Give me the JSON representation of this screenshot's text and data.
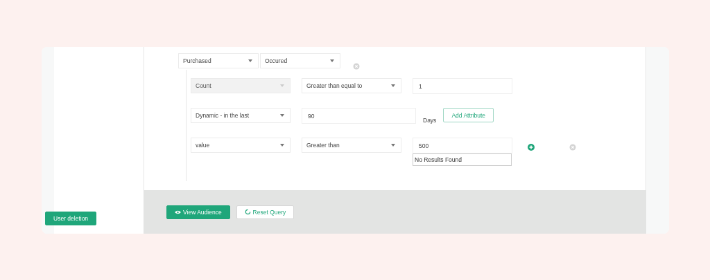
{
  "sidebar": {
    "button": "User deletion"
  },
  "event_row": {
    "selects": [
      {
        "value": "Purchased"
      },
      {
        "value": "Occured"
      }
    ],
    "can_remove": true
  },
  "conditions": [
    {
      "kind": "compare",
      "attribute": {
        "value": "Count",
        "disabled": true
      },
      "operator": "Greater than equal to",
      "value": "1"
    },
    {
      "kind": "range",
      "attribute": {
        "value": "Dynamic - in the last",
        "disabled": false
      },
      "value": "90",
      "unit": "Days",
      "button": "Add Attribute"
    },
    {
      "kind": "compare",
      "attribute": {
        "value": "value",
        "disabled": false
      },
      "operator": "Greater than",
      "value": "500",
      "suggestion": "No Results Found",
      "can_add": true,
      "can_remove": true
    }
  ],
  "footer": {
    "buttons": [
      {
        "label": "View Audience",
        "kind": "primary"
      },
      {
        "label": "Reset Query",
        "kind": "secondary"
      }
    ]
  }
}
